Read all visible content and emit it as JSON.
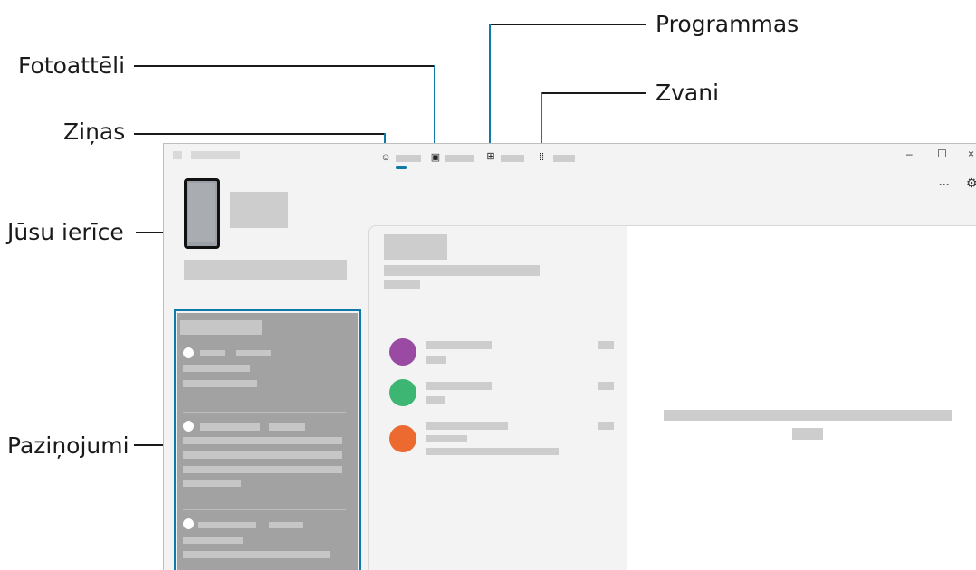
{
  "callouts": {
    "programmas": "Programmas",
    "fotoatteli": "Fotoattēli",
    "zvani": "Zvani",
    "zinas": "Ziņas",
    "jusu_ierice": "Jūsu ierīce",
    "pazinojumi": "Paziņojumi"
  },
  "window": {
    "minimize_glyph": "–",
    "maximize_glyph": "☐",
    "close_glyph": "×",
    "more_glyph": "···",
    "settings_glyph": "⚙"
  },
  "tabs": {
    "messages_icon": "messages-icon",
    "photos_icon": "photos-icon",
    "apps_icon": "apps-icon",
    "calls_icon": "dialpad-icon",
    "messages_glyph": "☺",
    "photos_glyph": "▣",
    "apps_glyph": "⊞",
    "calls_glyph": "⁞⁞"
  },
  "colors": {
    "accent": "#0f79a9",
    "contact_1": "#9b4aa3",
    "contact_2": "#3cb672",
    "contact_3": "#ec6a2f",
    "notifications_bg": "#a2a2a2"
  }
}
